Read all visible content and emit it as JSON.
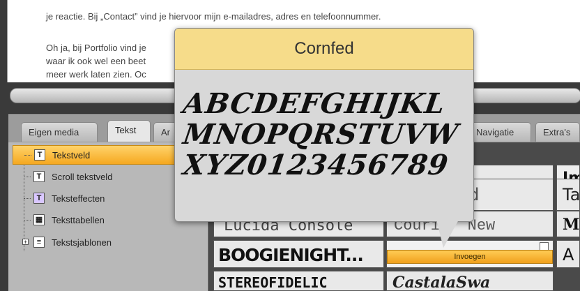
{
  "document": {
    "line_top_fragment": "",
    "paragraph1": "je reactie. Bij „Contact” vind je hiervoor mijn e-mailadres, adres en telefoonnummer.",
    "paragraph2_lines": [
      "Oh ja, bij Portfolio vind je",
      "waar ik ook wel een beet",
      "meer werk laten zien. Oc"
    ]
  },
  "tabs": [
    "Eigen media",
    "Tekst",
    "Ar",
    "Navigatie",
    "Extra's"
  ],
  "tree": {
    "items": [
      {
        "label": "Tekstveld",
        "icon": "text-field-icon",
        "glyph": "T",
        "active": true
      },
      {
        "label": "Scroll tekstveld",
        "icon": "scroll-text-icon",
        "glyph": "T",
        "active": false
      },
      {
        "label": "Teksteffecten",
        "icon": "text-effects-icon",
        "glyph": "T",
        "active": false
      },
      {
        "label": "Teksttabellen",
        "icon": "table-icon",
        "glyph": "▦",
        "active": false
      },
      {
        "label": "Tekstsjablonen",
        "icon": "template-icon",
        "glyph": "≡",
        "active": false
      }
    ]
  },
  "font_grid": {
    "cells": [
      {
        "label": "",
        "font": "row1-left"
      },
      {
        "label": "",
        "font": "row1-mid"
      },
      {
        "label": "Im",
        "font": "impact"
      },
      {
        "label": "d",
        "font": "row2-mid"
      },
      {
        "label": "Ta",
        "font": "tahoma"
      },
      {
        "label": "Lucida Console",
        "font": "lucida-console"
      },
      {
        "label": "Courier New",
        "font": "courier-new"
      },
      {
        "label": "M",
        "font": "row3-right"
      },
      {
        "label": "BOOGIENIGHT...",
        "font": "boogienight"
      },
      {
        "label": "",
        "font": "cornfed-thumb"
      },
      {
        "label": "A",
        "font": "row4-right"
      },
      {
        "label": "STEREOFIDELIC",
        "font": "stereofidelic"
      },
      {
        "label": "CastalaSwa",
        "font": "castala"
      }
    ]
  },
  "insert_button": "Invoegen",
  "popup": {
    "title": "Cornfed",
    "sample_lines": [
      "ABCDEFGHIJKL",
      "MNOPQRSTUVW",
      "XYZ0123456789"
    ]
  }
}
